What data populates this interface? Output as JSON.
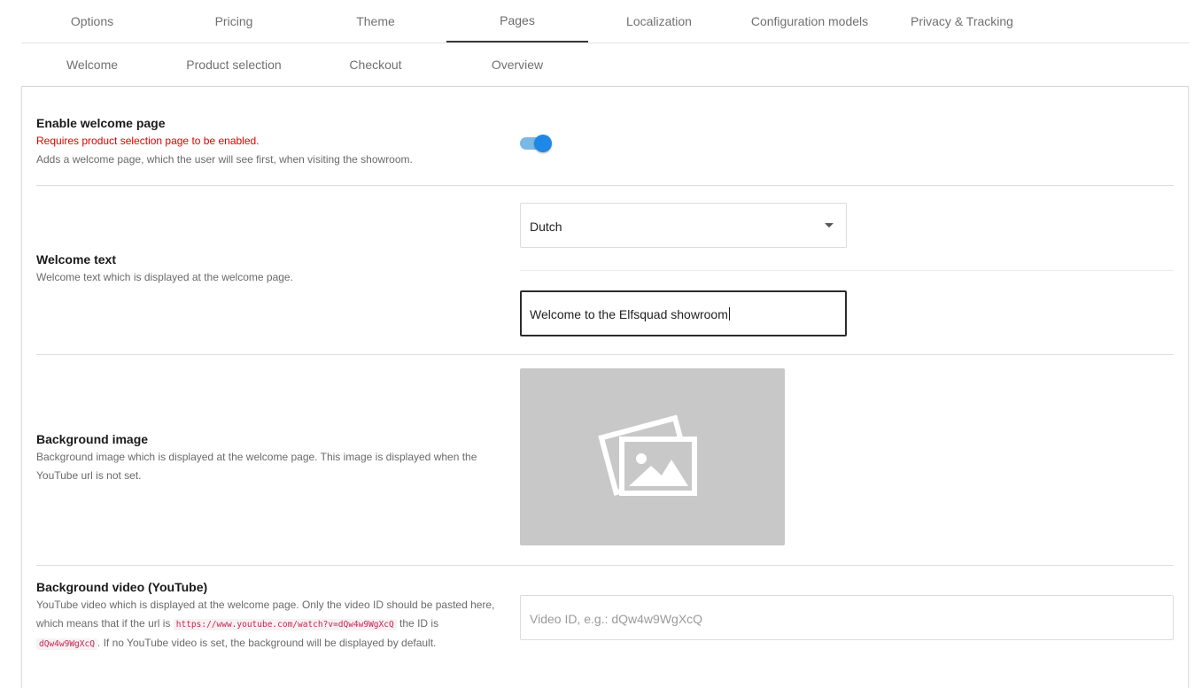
{
  "primary_tabs": [
    {
      "label": "Options"
    },
    {
      "label": "Pricing"
    },
    {
      "label": "Theme"
    },
    {
      "label": "Pages",
      "active": true
    },
    {
      "label": "Localization"
    },
    {
      "label": "Configuration models"
    },
    {
      "label": "Privacy & Tracking"
    }
  ],
  "secondary_tabs": [
    {
      "label": "Welcome",
      "active": true
    },
    {
      "label": "Product selection"
    },
    {
      "label": "Checkout"
    },
    {
      "label": "Overview"
    }
  ],
  "settings": {
    "enable_welcome": {
      "label": "Enable welcome page",
      "warning": "Requires product selection page to be enabled.",
      "description": "Adds a welcome page, which the user will see first, when visiting the showroom.",
      "enabled": true
    },
    "welcome_text": {
      "label": "Welcome text",
      "description": "Welcome text which is displayed at the welcome page.",
      "language": "Dutch",
      "value": "Welcome to the Elfsquad showroom"
    },
    "background_image": {
      "label": "Background image",
      "description_line1": "Background image which is displayed at the welcome page. This image is displayed when the",
      "description_line2": "YouTube url is not set.",
      "placeholder_icon": "image-placeholder-icon"
    },
    "background_video": {
      "label": "Background video (YouTube)",
      "description_line1": "YouTube video which is displayed at the welcome page. Only the video ID should be pasted here,",
      "description_line2_pre": "which means that if the url is",
      "example_url": "https://www.youtube.com/watch?v=dQw4w9WgXcQ",
      "description_line2_post": "the ID is",
      "example_id": "dQw4w9WgXcQ",
      "description_line3_post": ". If no YouTube video is set, the background will be displayed by default.",
      "placeholder": "Video ID, e.g.: dQw4w9WgXcQ"
    }
  },
  "colors": {
    "accent": "#1e88e5",
    "warning": "#e00000",
    "code": "#c7254e"
  }
}
